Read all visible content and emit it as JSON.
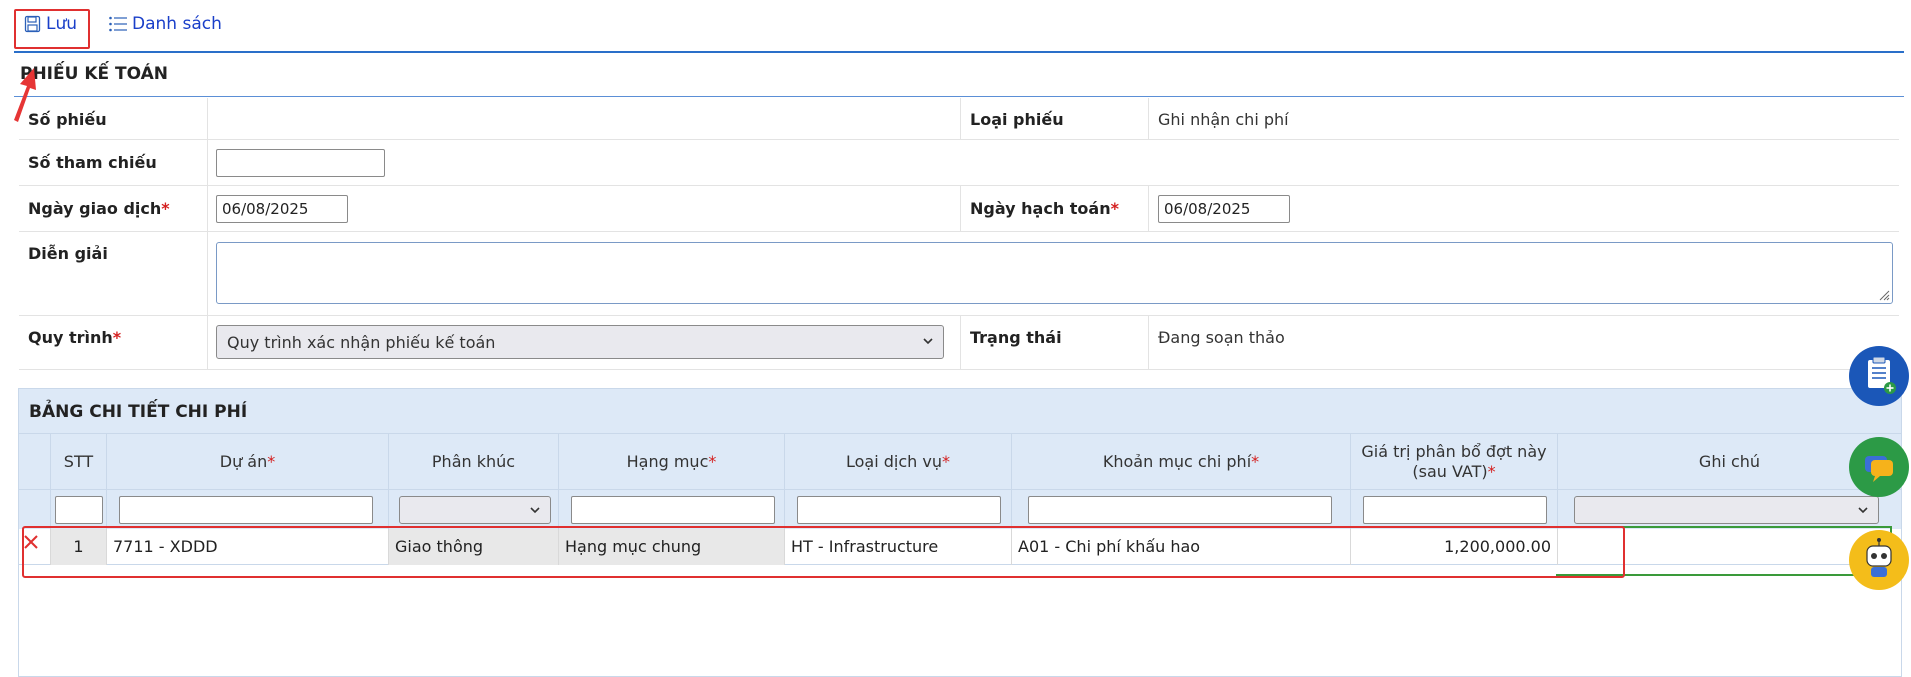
{
  "toolbar": {
    "save_label": "Lưu",
    "list_label": "Danh sách"
  },
  "form": {
    "section_title": "PHIẾU KẾ TOÁN",
    "so_phieu_label": "Số phiếu",
    "so_phieu_value": "",
    "loai_phieu_label": "Loại phiếu",
    "loai_phieu_value": "Ghi nhận chi phí",
    "so_tham_chieu_label": "Số tham chiếu",
    "so_tham_chieu_value": "",
    "ngay_giao_dich_label": "Ngày giao dịch",
    "ngay_giao_dich_value": "06/08/2025",
    "ngay_hach_toan_label": "Ngày hạch toán",
    "ngay_hach_toan_value": "06/08/2025",
    "dien_giai_label": "Diễn giải",
    "dien_giai_value": "",
    "quy_trinh_label": "Quy trình",
    "quy_trinh_value": "Quy trình xác nhận phiếu kế toán",
    "trang_thai_label": "Trạng thái",
    "trang_thai_value": "Đang soạn thảo",
    "required_mark": "*"
  },
  "grid": {
    "title": "BẢNG CHI TIẾT CHI PHÍ",
    "columns": {
      "stt": "STT",
      "du_an": "Dự án",
      "phan_khuc": "Phân khúc",
      "hang_muc": "Hạng mục",
      "loai_dich_vu": "Loại dịch vụ",
      "khoan_muc": "Khoản mục chi phí",
      "gia_tri_1": "Giá trị phân bổ đợt này",
      "gia_tri_2": "(sau VAT)",
      "ghi_chu": "Ghi chú"
    },
    "rows": [
      {
        "stt": "1",
        "du_an": "7711 - XDDD",
        "phan_khuc": "Giao thông",
        "hang_muc": "Hạng mục chung",
        "loai_dich_vu": "HT - Infrastructure",
        "khoan_muc": "A01 - Chi phí khấu hao",
        "gia_tri": "1,200,000.00",
        "ghi_chu": ""
      }
    ]
  },
  "colors": {
    "accent": "#1a3fc9",
    "highlight": "#e03030",
    "header_bg": "#dde9f7"
  }
}
